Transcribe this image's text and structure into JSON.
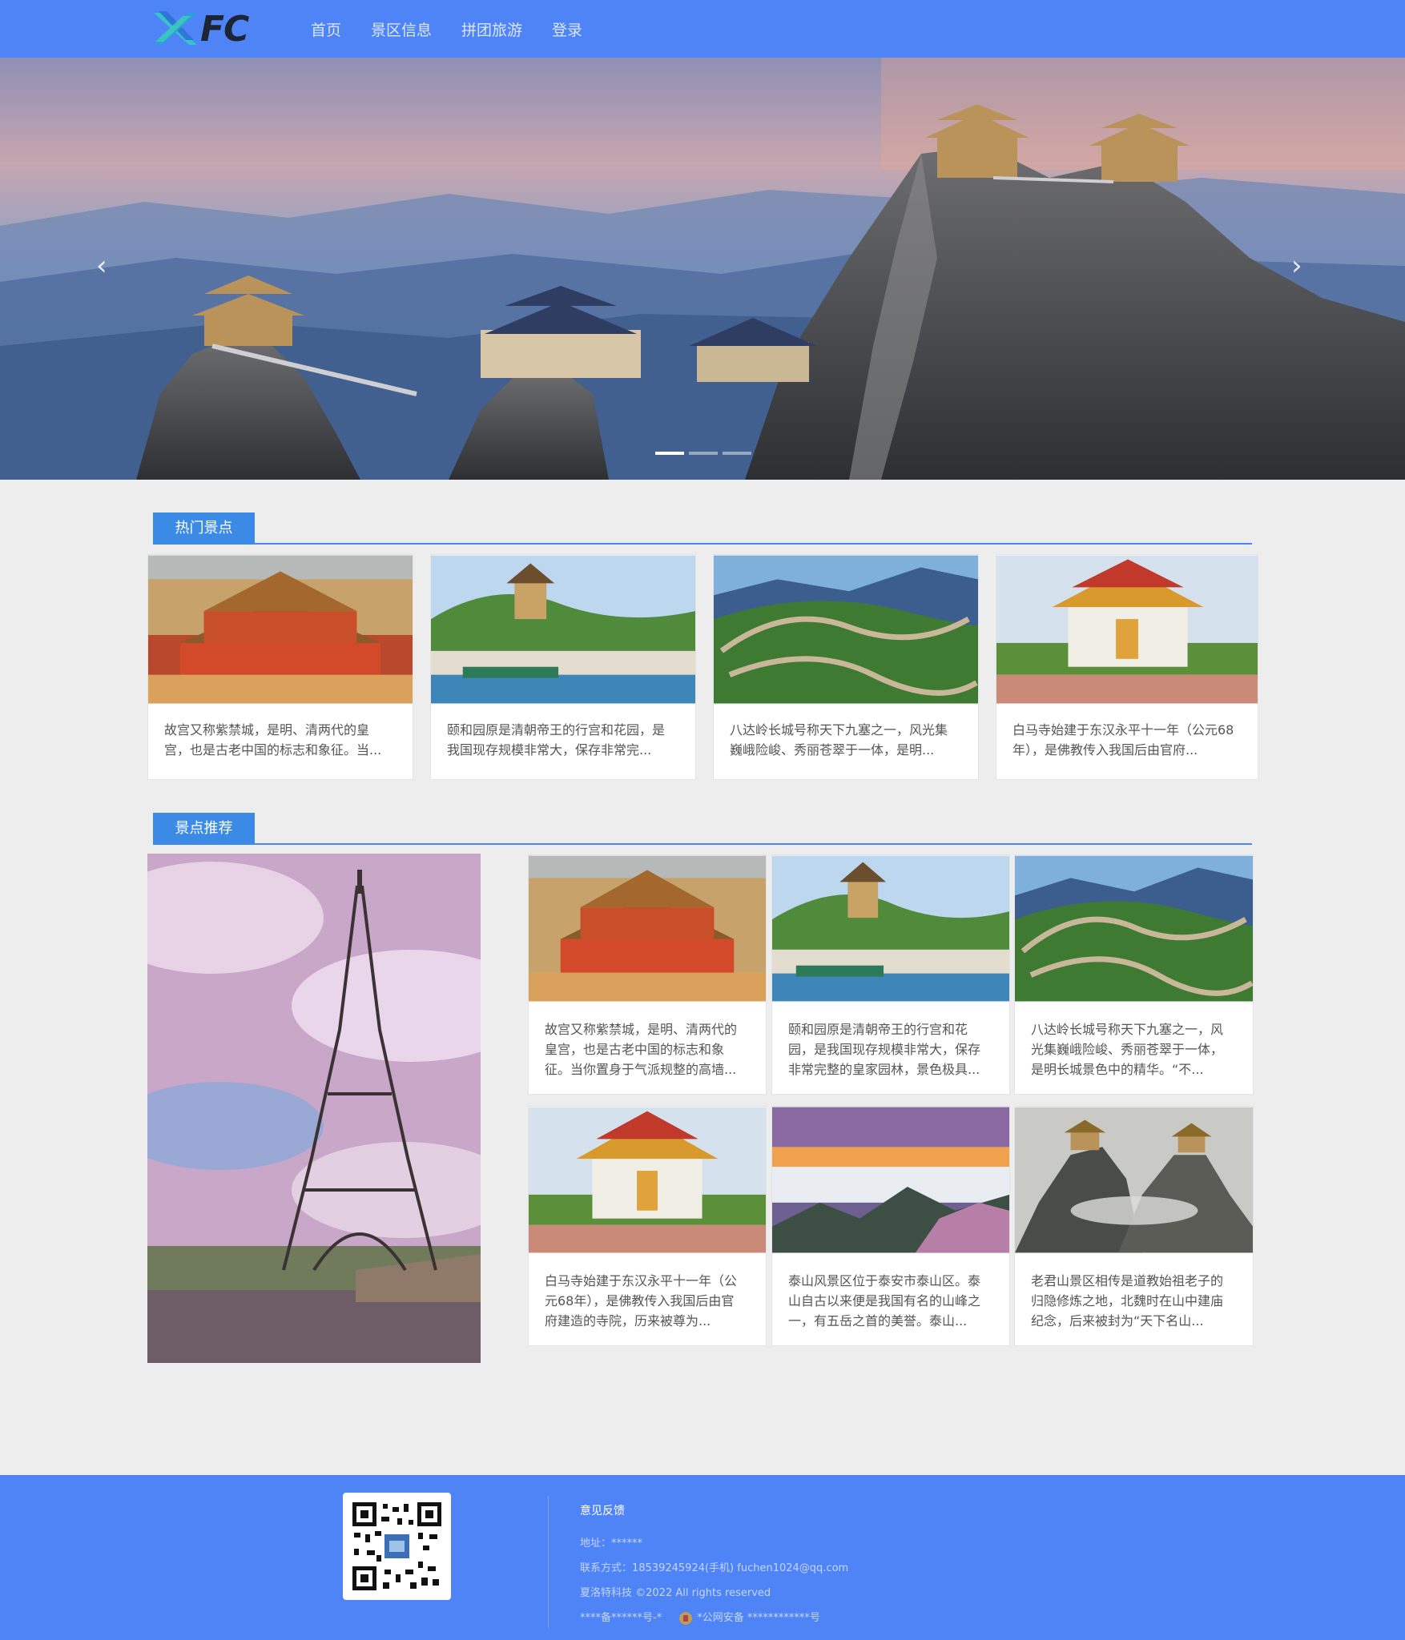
{
  "brand": {
    "logo_text": "FC"
  },
  "nav": {
    "items": [
      "首页",
      "景区信息",
      "拼团旅游",
      "登录"
    ]
  },
  "banner": {
    "prev_label": "‹",
    "next_label": "›",
    "slides": 3,
    "active_slide": 1
  },
  "hot": {
    "title": "热门景点",
    "cards": [
      {
        "line1": "故宫又称紫禁城，是明、清两代的皇",
        "line2": "宫，也是古老中国的标志和象征。当..."
      },
      {
        "line1": "颐和园原是清朝帝王的行宫和花园，是",
        "line2": "我国现存规模非常大，保存非常完..."
      },
      {
        "line1": "八达岭长城号称天下九塞之一，风光集",
        "line2": "巍峨险峻、秀丽苍翠于一体，是明..."
      },
      {
        "line1": "白马寺始建于东汉永平十一年（公元68",
        "line2": "年），是佛教传入我国后由官府..."
      }
    ]
  },
  "recommend": {
    "title": "景点推荐",
    "cards": [
      {
        "line1": "故宫又称紫禁城，是明、清两代的",
        "line2": "皇宫，也是古老中国的标志和象",
        "line3": "征。当你置身于气派规整的高墙..."
      },
      {
        "line1": "颐和园原是清朝帝王的行宫和花",
        "line2": "园，是我国现存规模非常大，保存",
        "line3": "非常完整的皇家园林，景色极具..."
      },
      {
        "line1": "八达岭长城号称天下九塞之一，风",
        "line2": "光集巍峨险峻、秀丽苍翠于一体，",
        "line3": "是明长城景色中的精华。“不..."
      },
      {
        "line1": "白马寺始建于东汉永平十一年（公",
        "line2": "元68年），是佛教传入我国后由官",
        "line3": "府建造的寺院，历来被尊为..."
      },
      {
        "line1": "泰山风景区位于泰安市泰山区。泰",
        "line2": "山自古以来便是我国有名的山峰之",
        "line3": "一，有五岳之首的美誉。泰山..."
      },
      {
        "line1": "老君山景区相传是道教始祖老子的",
        "line2": "归隐修炼之地，北魏时在山中建庙",
        "line3": "纪念，后来被封为“天下名山..."
      }
    ]
  },
  "footer": {
    "title": "意见反馈",
    "address": "地址：******",
    "contact": "联系方式：18539245924(手机)    fuchen1024@qq.com",
    "copyright": "夏洛特科技 ©2022 All rights reserved",
    "icp": "****备******号-*",
    "police": "*公网安备 ************号"
  },
  "colors": {
    "header_bg": "#4f84f6",
    "section_tab": "#3a8ae6",
    "page_bg": "#ededed"
  }
}
